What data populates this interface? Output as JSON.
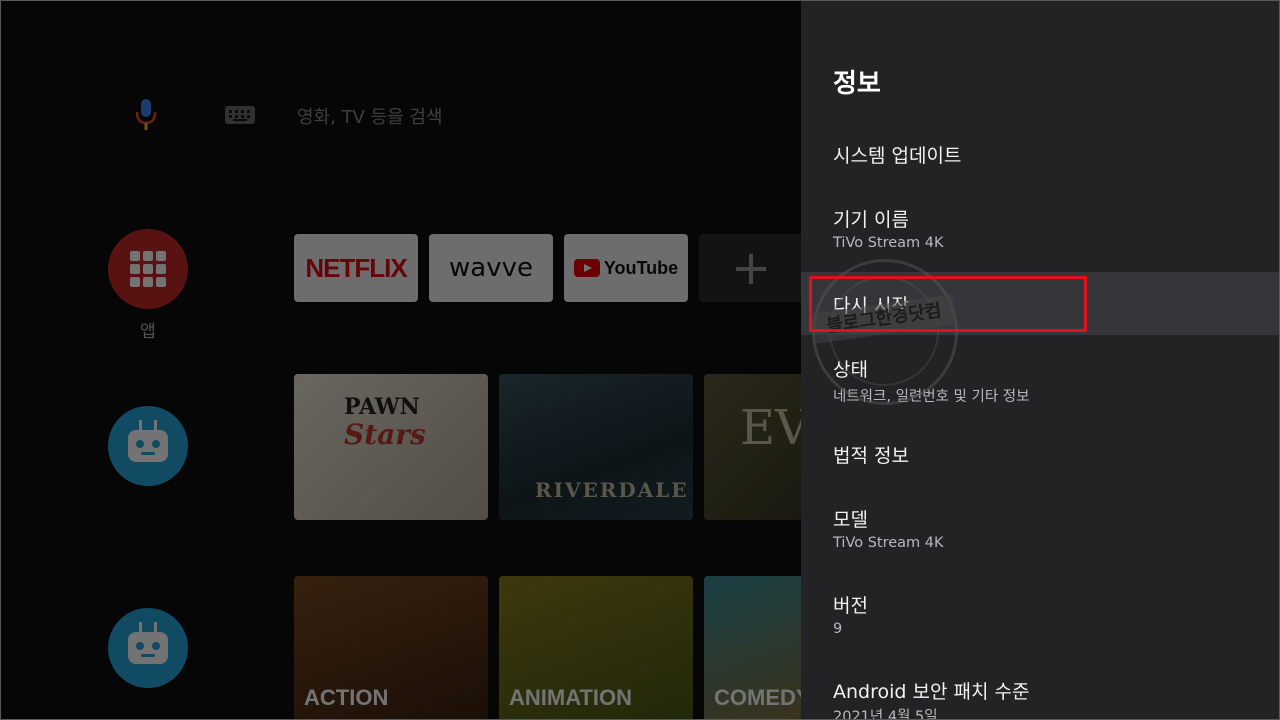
{
  "home": {
    "search_placeholder": "영화, TV 등을 검색",
    "apps_label": "앱",
    "app_tiles": [
      "NETFLIX",
      "wavve",
      "YouTube",
      "+"
    ],
    "poster_texts": [
      "PAWN",
      "Stars",
      "RIVERDALE",
      "EV"
    ],
    "genres": [
      "ACTION",
      "ANIMATION",
      "COMEDY"
    ]
  },
  "panel": {
    "title": "정보",
    "items": [
      {
        "label": "시스템 업데이트",
        "sub": ""
      },
      {
        "label": "기기 이름",
        "sub": "TiVo Stream 4K"
      },
      {
        "label": "다시 시작",
        "sub": ""
      },
      {
        "label": "상태",
        "sub": "네트워크, 일련번호 및 기타 정보"
      },
      {
        "label": "법적 정보",
        "sub": ""
      },
      {
        "label": "모델",
        "sub": "TiVo Stream 4K"
      },
      {
        "label": "버전",
        "sub": "9"
      },
      {
        "label": "Android 보안 패치 수준",
        "sub": "2021년 4월 5일"
      }
    ]
  },
  "stamp_text": "블로그한경닷컴",
  "colors": {
    "panel_bg": "#232326",
    "focused_bg": "#36363a",
    "highlight": "#e0101d",
    "apps_red": "#c62828",
    "tivo_blue": "#26a5dc"
  }
}
